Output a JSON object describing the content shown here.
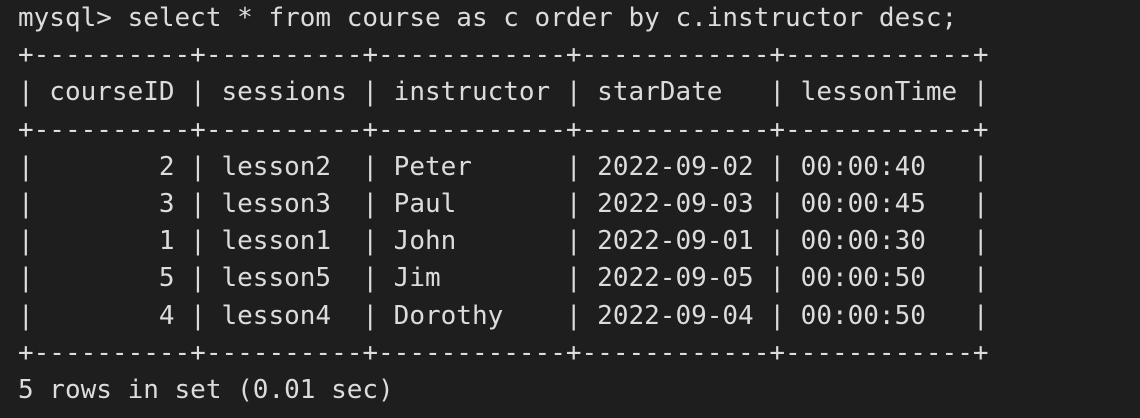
{
  "terminal": {
    "prompt": "mysql> select * from course as c order by c.instructor desc;",
    "table": {
      "columns": [
        "courseID",
        "sessions",
        "instructor",
        "starDate",
        "lessonTime"
      ],
      "rows": [
        [
          "2",
          "lesson2",
          "Peter",
          "2022-09-02",
          "00:00:40"
        ],
        [
          "3",
          "lesson3",
          "Paul",
          "2022-09-03",
          "00:00:45"
        ],
        [
          "1",
          "lesson1",
          "John",
          "2022-09-01",
          "00:00:30"
        ],
        [
          "5",
          "lesson5",
          "Jim",
          "2022-09-05",
          "00:00:50"
        ],
        [
          "4",
          "lesson4",
          "Dorothy",
          "2022-09-04",
          "00:00:50"
        ]
      ]
    },
    "result_summary": "5 rows in set (0.01 sec)"
  },
  "lines": [
    "mysql> select * from course as c order by c.instructor desc;",
    "+----------+----------+------------+------------+------------+",
    "| courseID | sessions | instructor | starDate   | lessonTime |",
    "+----------+----------+------------+------------+------------+",
    "|        2 | lesson2  | Peter      | 2022-09-02 | 00:00:40   |",
    "|        3 | lesson3  | Paul       | 2022-09-03 | 00:00:45   |",
    "|        1 | lesson1  | John       | 2022-09-01 | 00:00:30   |",
    "|        5 | lesson5  | Jim        | 2022-09-05 | 00:00:50   |",
    "|        4 | lesson4  | Dorothy    | 2022-09-04 | 00:00:50   |",
    "+----------+----------+------------+------------+------------+",
    "5 rows in set (0.01 sec)"
  ],
  "colors": {
    "background": "#1e1e1e",
    "text": "#dcdcdc"
  }
}
